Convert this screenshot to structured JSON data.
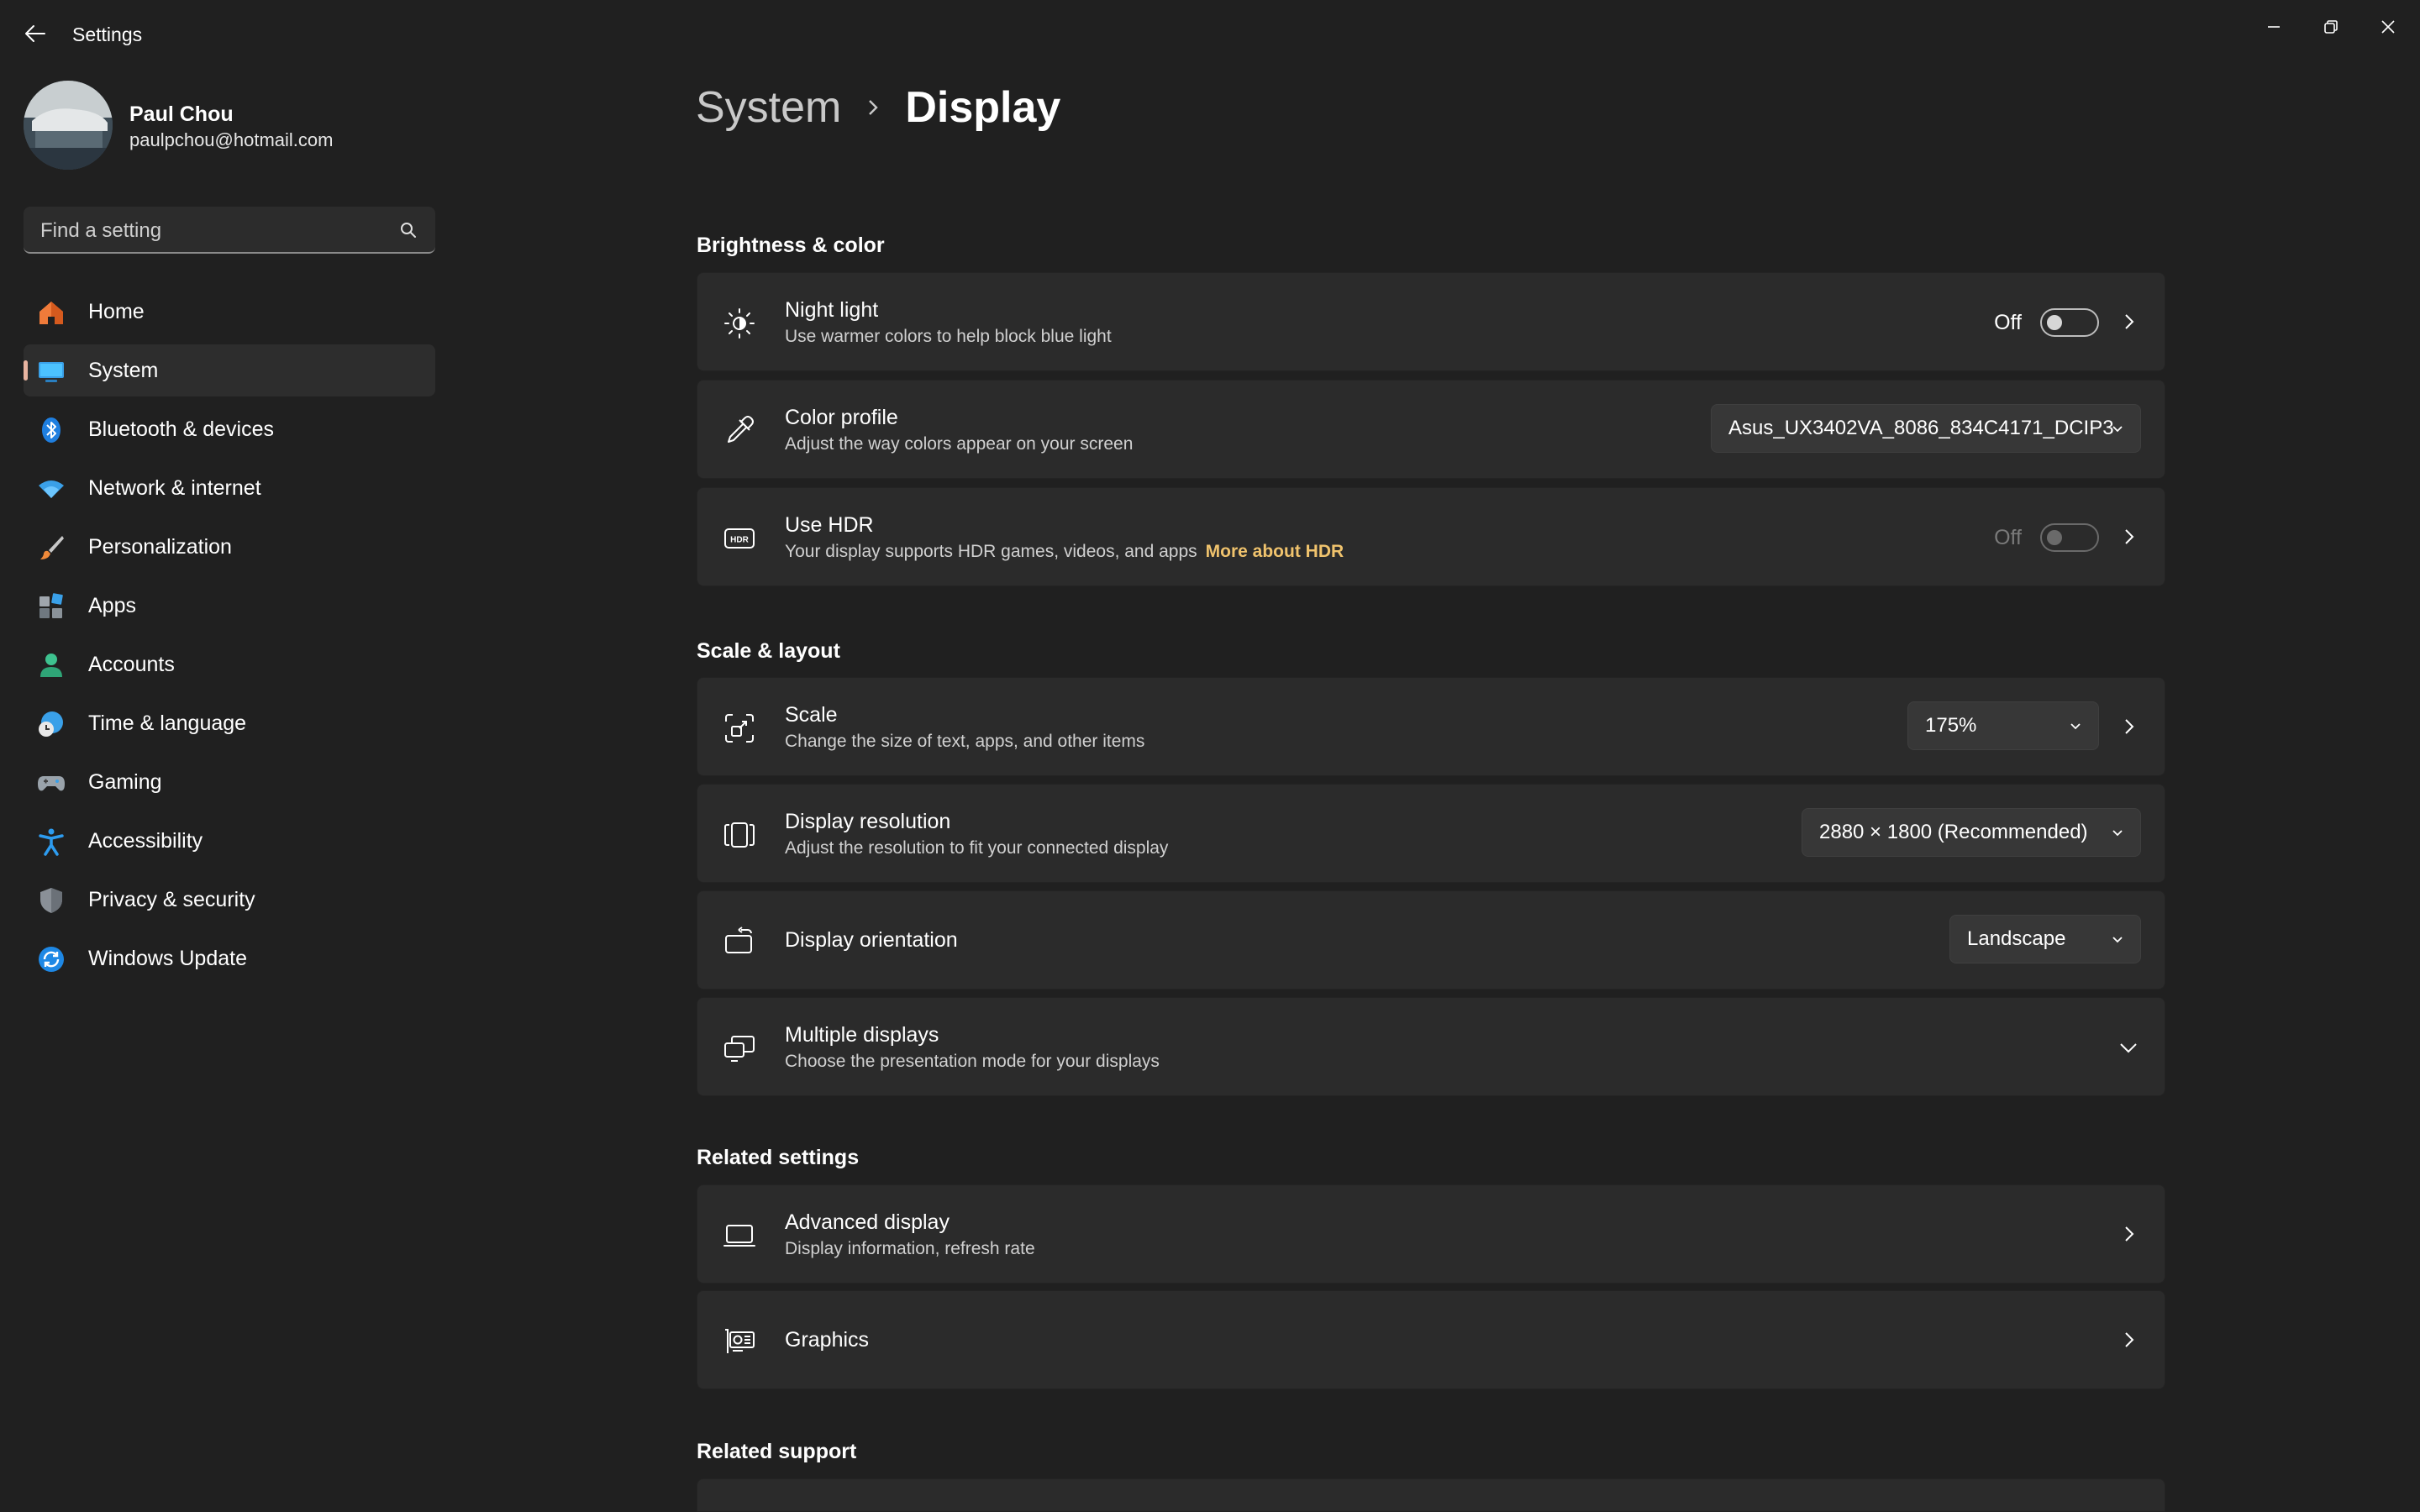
{
  "app": {
    "title": "Settings"
  },
  "profile": {
    "name": "Paul Chou",
    "email": "paulpchou@hotmail.com"
  },
  "search": {
    "placeholder": "Find a setting"
  },
  "nav": {
    "items": [
      {
        "label": "Home",
        "icon": "home-icon"
      },
      {
        "label": "System",
        "icon": "system-icon",
        "active": true
      },
      {
        "label": "Bluetooth & devices",
        "icon": "bluetooth-icon"
      },
      {
        "label": "Network & internet",
        "icon": "wifi-icon"
      },
      {
        "label": "Personalization",
        "icon": "brush-icon"
      },
      {
        "label": "Apps",
        "icon": "apps-icon"
      },
      {
        "label": "Accounts",
        "icon": "accounts-icon"
      },
      {
        "label": "Time & language",
        "icon": "clock-globe-icon"
      },
      {
        "label": "Gaming",
        "icon": "gamepad-icon"
      },
      {
        "label": "Accessibility",
        "icon": "accessibility-icon"
      },
      {
        "label": "Privacy & security",
        "icon": "shield-icon"
      },
      {
        "label": "Windows Update",
        "icon": "update-icon"
      }
    ]
  },
  "breadcrumb": {
    "parent": "System",
    "current": "Display"
  },
  "sections": {
    "brightness": "Brightness & color",
    "scale": "Scale & layout",
    "related_settings": "Related settings",
    "related_support": "Related support"
  },
  "cards": {
    "night_light": {
      "title": "Night light",
      "subtitle": "Use warmer colors to help block blue light",
      "toggle": "Off"
    },
    "color_profile": {
      "title": "Color profile",
      "subtitle": "Adjust the way colors appear on your screen",
      "value": "Asus_UX3402VA_8086_834C4171_DCIP3"
    },
    "hdr": {
      "title": "Use HDR",
      "subtitle": "Your display supports HDR games, videos, and apps",
      "link": "More about HDR",
      "toggle": "Off"
    },
    "scale": {
      "title": "Scale",
      "subtitle": "Change the size of text, apps, and other items",
      "value": "175%"
    },
    "resolution": {
      "title": "Display resolution",
      "subtitle": "Adjust the resolution to fit your connected display",
      "value": "2880 × 1800 (Recommended)"
    },
    "orientation": {
      "title": "Display orientation",
      "value": "Landscape"
    },
    "multiple": {
      "title": "Multiple displays",
      "subtitle": "Choose the presentation mode for your displays"
    },
    "advanced": {
      "title": "Advanced display",
      "subtitle": "Display information, refresh rate"
    },
    "graphics": {
      "title": "Graphics"
    }
  },
  "colors": {
    "accent_indicator": "#e8b4a0",
    "link": "#f0c36d",
    "background": "#202020",
    "card": "#2b2b2b"
  }
}
